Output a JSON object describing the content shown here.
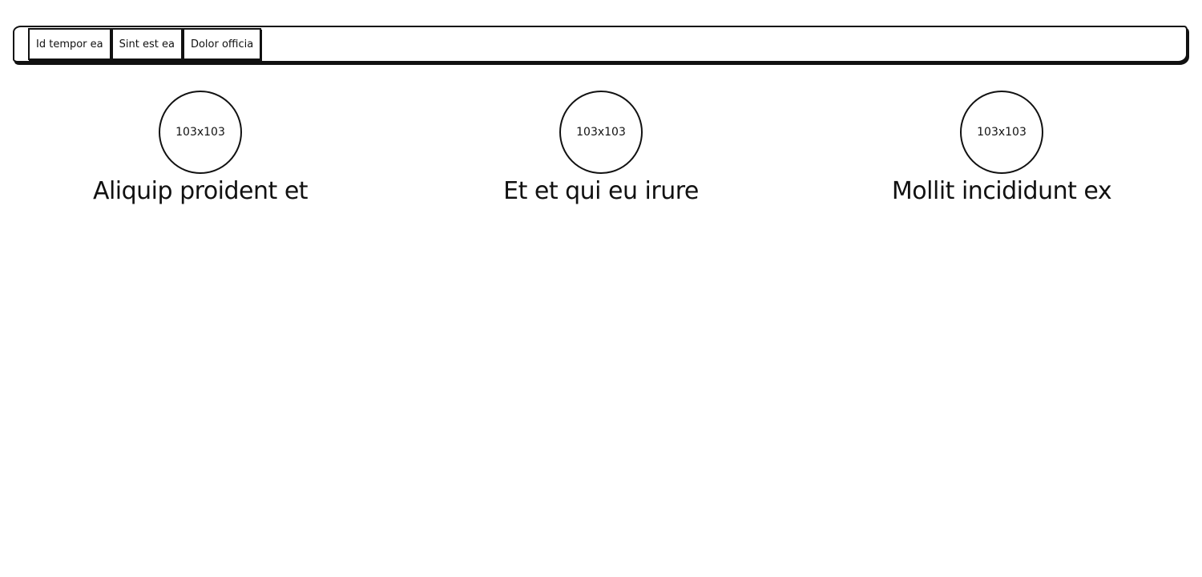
{
  "nav": {
    "tabs": [
      {
        "label": "Id tempor ea"
      },
      {
        "label": "Sint est ea"
      },
      {
        "label": "Dolor officia"
      }
    ]
  },
  "features": [
    {
      "image_label": "103x103",
      "title": "Aliquip proident et"
    },
    {
      "image_label": "103x103",
      "title": "Et et qui eu irure"
    },
    {
      "image_label": "103x103",
      "title": "Mollit incididunt ex"
    }
  ],
  "colors": {
    "stroke": "#111111",
    "background": "#ffffff"
  }
}
